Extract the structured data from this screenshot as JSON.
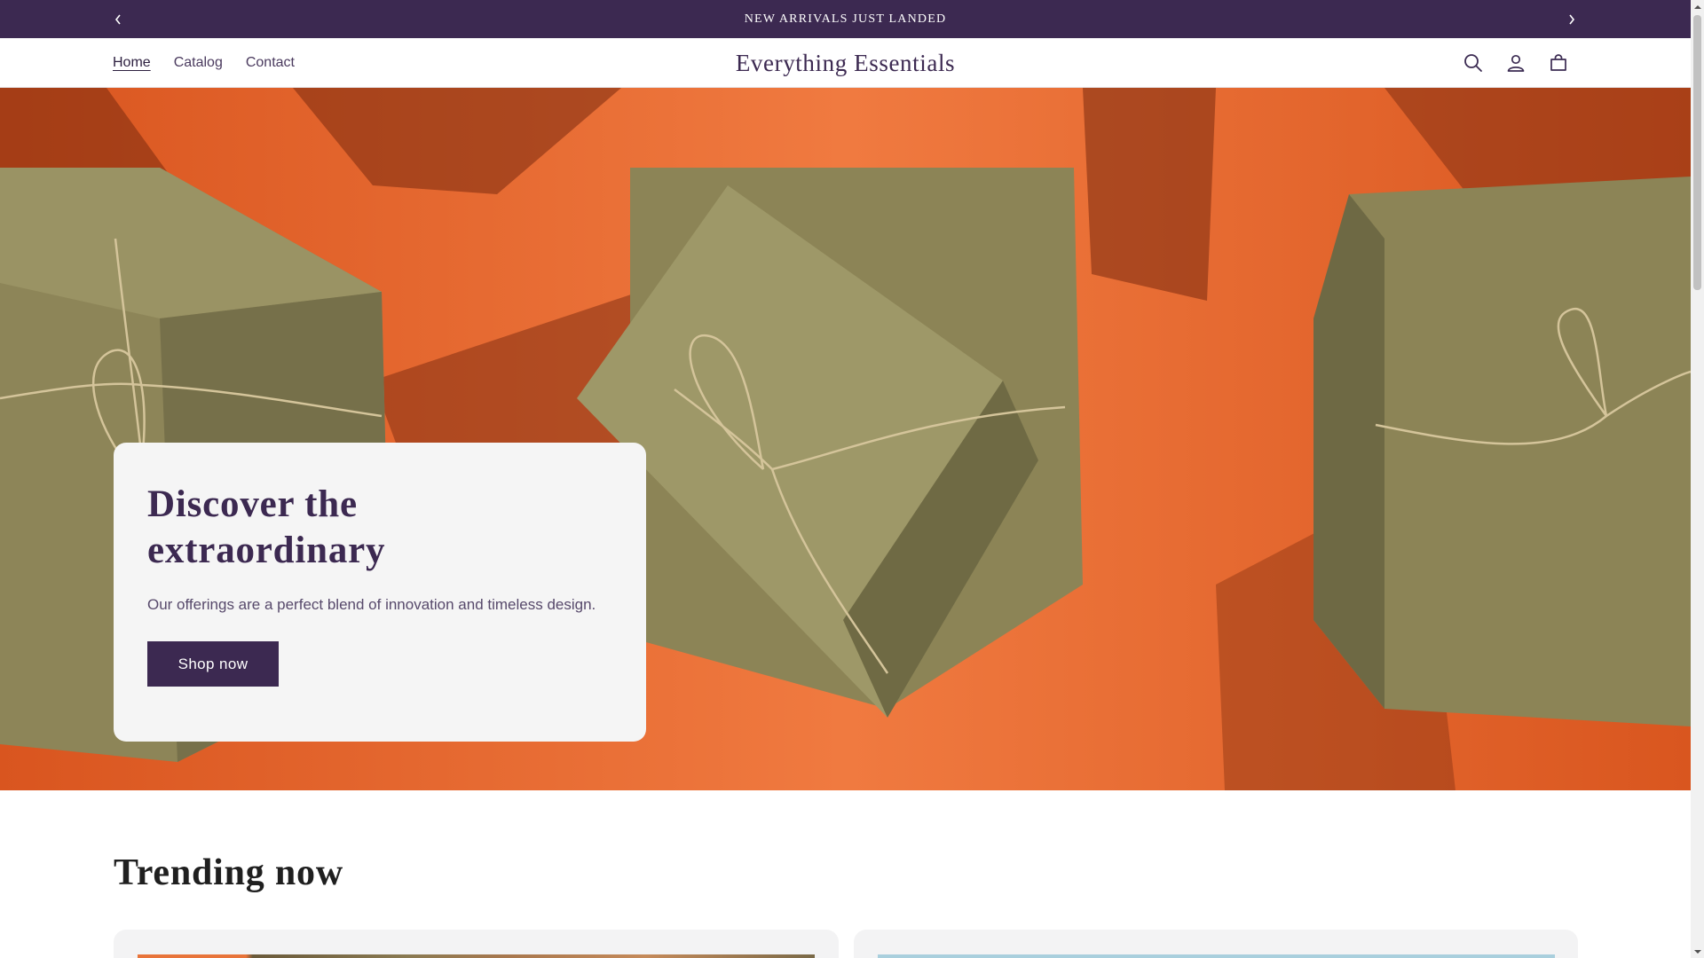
{
  "announcement": {
    "text": "NEW ARRIVALS JUST LANDED",
    "prev_icon": "chevron-left-icon",
    "next_icon": "chevron-right-icon"
  },
  "header": {
    "nav": [
      {
        "label": "Home",
        "active": true
      },
      {
        "label": "Catalog",
        "active": false
      },
      {
        "label": "Contact",
        "active": false
      }
    ],
    "logo": "Everything Essentials",
    "icons": [
      "search-icon",
      "account-icon",
      "cart-icon"
    ]
  },
  "hero": {
    "title": "Discover the extraordinary",
    "subtitle": "Our offerings are a perfect blend of innovation and timeless design.",
    "button_label": "Shop now"
  },
  "trending": {
    "title": "Trending now"
  },
  "colors": {
    "brand": "#3c2951",
    "hero_background": "#e2602c",
    "box_olive": "#8c8456",
    "card_background": "#f5f5f5"
  }
}
